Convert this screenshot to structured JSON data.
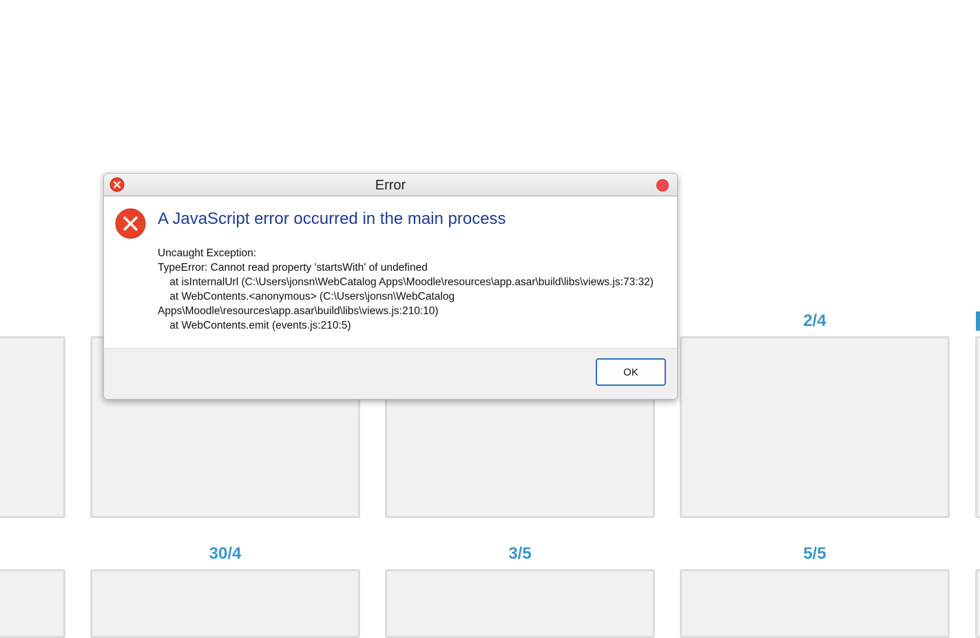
{
  "background": {
    "labels": [
      {
        "id": "label-2-4",
        "text": "2/4"
      },
      {
        "id": "label-30-4",
        "text": "30/4"
      },
      {
        "id": "label-3-5",
        "text": "3/5"
      },
      {
        "id": "label-5-5",
        "text": "5/5"
      }
    ],
    "accent_color": "#3a96c8"
  },
  "dialog": {
    "title": "Error",
    "title_icon": "error-icon",
    "close_icon": "close-icon",
    "heading": "A JavaScript error occurred in the main process",
    "message_lines": [
      "Uncaught Exception:",
      "TypeError: Cannot read property 'startsWith' of undefined",
      "    at isInternalUrl (C:\\Users\\jonsn\\WebCatalog Apps\\Moodle\\resources\\app.asar\\build\\libs\\views.js:73:32)",
      "    at WebContents.<anonymous> (C:\\Users\\jonsn\\WebCatalog",
      "Apps\\Moodle\\resources\\app.asar\\build\\libs\\views.js:210:10)",
      "    at WebContents.emit (events.js:210:5)"
    ],
    "ok_label": "OK",
    "heading_color": "#1e3c91",
    "error_color": "#e8412a"
  }
}
